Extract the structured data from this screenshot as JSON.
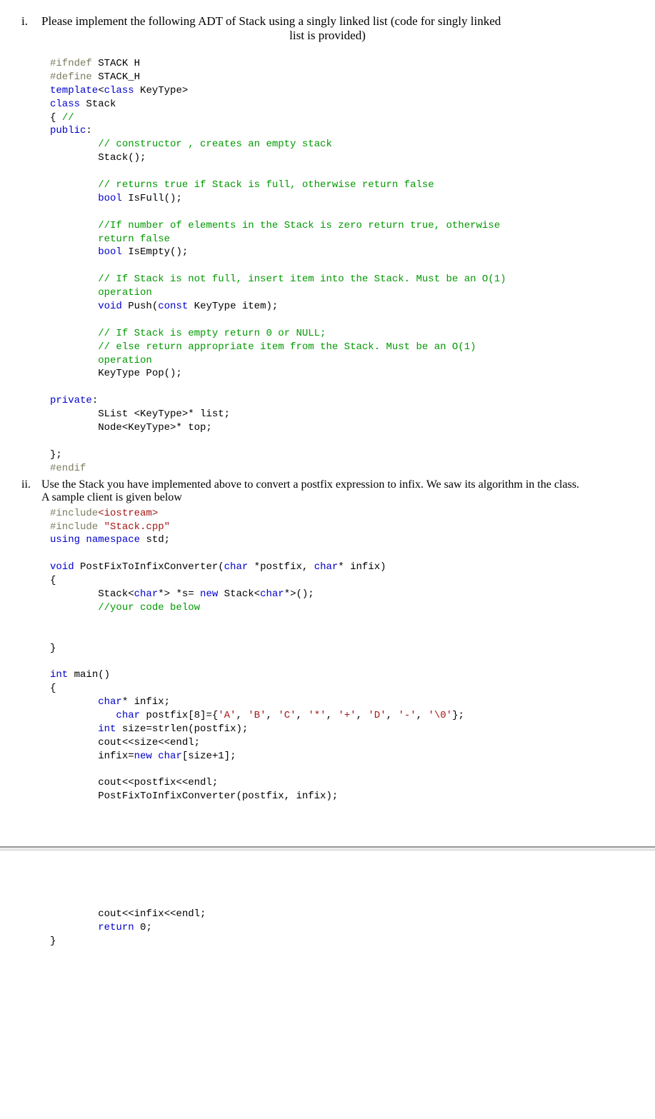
{
  "q1": {
    "roman": "i.",
    "line1": "Please implement the following ADT of Stack using a singly linked list (code for  singly linked",
    "line2": "list is provided)"
  },
  "code1": {
    "l01a": "#ifndef",
    "l01b": " STACK H",
    "l02a": "#define",
    "l02b": " STACK_H",
    "l03a": "template",
    "l03b": "<",
    "l03c": "class",
    "l03d": " KeyType>",
    "l04a": "class",
    "l04b": " Stack",
    "l05a": "{ ",
    "l05b": "//",
    "l06a": "public",
    "l06b": ":",
    "l07": "        // constructor , creates an empty stack",
    "l08": "        Stack();",
    "l09": "",
    "l10": "        // returns true if Stack is full, otherwise return false",
    "l11a": "        ",
    "l11b": "bool",
    "l11c": " IsFull();",
    "l12": "",
    "l13": "        //If number of elements in the Stack is zero return true, otherwise",
    "l13b": "        return false",
    "l14a": "        ",
    "l14b": "bool",
    "l14c": " IsEmpty();",
    "l15": "",
    "l16": "        // If Stack is not full, insert item into the Stack. Must be an O(1)",
    "l16b": "        operation",
    "l17a": "        ",
    "l17b": "void",
    "l17c": " Push(",
    "l17d": "const",
    "l17e": " KeyType item);",
    "l18": "",
    "l19": "        // If Stack is empty return 0 or NULL;",
    "l20": "        // else return appropriate item from the Stack. Must be an O(1)",
    "l20b": "        operation",
    "l21": "        KeyType Pop();",
    "l22": "",
    "l23a": "private",
    "l23b": ":",
    "l24": "        SList <KeyType>* list;",
    "l25": "        Node<KeyType>* top;",
    "l26": "",
    "l27": "};",
    "l28": "#endif"
  },
  "q2": {
    "roman": "ii.",
    "text1": "Use the Stack you have implemented above to convert a postfix expression to infix. We saw its  algorithm in the class.",
    "text2": "A sample client is given below"
  },
  "code2": {
    "l01a": "#include",
    "l01b": "<iostream>",
    "l02a": "#include ",
    "l02b": "\"Stack.cpp\"",
    "l03a": "using",
    "l03b": " ",
    "l03c": "namespace",
    "l03d": " std;",
    "l04": "",
    "l05a": "void",
    "l05b": " PostFixToInfixConverter(",
    "l05c": "char",
    "l05d": " *postfix, ",
    "l05e": "char",
    "l05f": "* infix)",
    "l06": "{",
    "l07a": "        Stack<",
    "l07b": "char",
    "l07c": "*> *s= ",
    "l07d": "new",
    "l07e": " Stack<",
    "l07f": "char",
    "l07g": "*>();",
    "l08": "        //your code below",
    "l09": "",
    "l10": "",
    "l11": "}",
    "l12": "",
    "l13a": "int",
    "l13b": " main()",
    "l14": "{",
    "l15a": "        ",
    "l15b": "char",
    "l15c": "* infix;",
    "l16a": "           ",
    "l16b": "char",
    "l16c": " postfix[8]={",
    "l16d": "'A'",
    "l16e": ", ",
    "l16f": "'B'",
    "l16g": ", ",
    "l16h": "'C'",
    "l16i": ", ",
    "l16j": "'*'",
    "l16k": ", ",
    "l16l": "'+'",
    "l16m": ", ",
    "l16n": "'D'",
    "l16o": ", ",
    "l16p": "'-'",
    "l16q": ", ",
    "l16r": "'\\0'",
    "l16s": "};",
    "l17a": "        ",
    "l17b": "int",
    "l17c": " size=strlen(postfix);",
    "l18": "        cout<<size<<endl;",
    "l19a": "        infix=",
    "l19b": "new",
    "l19c": " ",
    "l19d": "char",
    "l19e": "[size+1];",
    "l20": "",
    "l21": "        cout<<postfix<<endl;",
    "l22": "        PostFixToInfixConverter(postfix, infix);"
  },
  "code3": {
    "l01": "        cout<<infix<<endl;",
    "l02a": "        ",
    "l02b": "return",
    "l02c": " 0;",
    "l03": "}"
  }
}
